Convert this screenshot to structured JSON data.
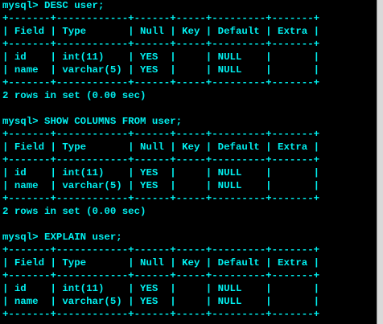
{
  "terminal": {
    "lines": [
      "mysql> DESC user;",
      "+-------+------------+------+-----+---------+-------+",
      "| Field | Type       | Null | Key | Default | Extra |",
      "+-------+------------+------+-----+---------+-------+",
      "| id    | int(11)    | YES  |     | NULL    |       |",
      "| name  | varchar(5) | YES  |     | NULL    |       |",
      "+-------+------------+------+-----+---------+-------+",
      "2 rows in set (0.00 sec)",
      "",
      "mysql> SHOW COLUMNS FROM user;",
      "+-------+------------+------+-----+---------+-------+",
      "| Field | Type       | Null | Key | Default | Extra |",
      "+-------+------------+------+-----+---------+-------+",
      "| id    | int(11)    | YES  |     | NULL    |       |",
      "| name  | varchar(5) | YES  |     | NULL    |       |",
      "+-------+------------+------+-----+---------+-------+",
      "2 rows in set (0.00 sec)",
      "",
      "mysql> EXPLAIN user;",
      "+-------+------------+------+-----+---------+-------+",
      "| Field | Type       | Null | Key | Default | Extra |",
      "+-------+------------+------+-----+---------+-------+",
      "| id    | int(11)    | YES  |     | NULL    |       |",
      "| name  | varchar(5) | YES  |     | NULL    |       |",
      "+-------+------------+------+-----+---------+-------+"
    ]
  },
  "colors": {
    "background": "#000000",
    "text": "#00f0f0"
  }
}
